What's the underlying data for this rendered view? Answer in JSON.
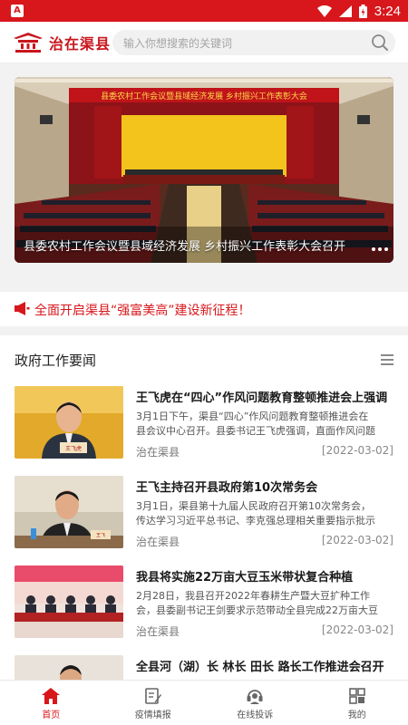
{
  "status_bar": {
    "time": "3:24",
    "app_badge": "A"
  },
  "header": {
    "logo_text": "治在渠县",
    "search_placeholder": "输入你想搜索的关键词"
  },
  "banner": {
    "caption": "县委农村工作会议暨县域经济发展 乡村振兴工作表彰大会召开",
    "stage_text": "县委农村工作会议暨县域经济发展  乡村振兴工作表彰大会"
  },
  "notice": {
    "text": "全面开启渠县“强富美高”建设新征程！"
  },
  "news": {
    "section_title": "政府工作要闻",
    "items": [
      {
        "title": "王飞虎在“四心”作风问题教育整顿推进会上强调",
        "summary_1": "3月1日下午，渠县“四心”作风问题教育整顿推进会在",
        "summary_2": "县会议中心召开。县委书记王飞虎强调，直面作风问题",
        "source": "治在渠县",
        "date": "[2022-03-02]",
        "nameplate": "王飞虎"
      },
      {
        "title": "王飞主持召开县政府第10次常务会",
        "summary_1": "3月1日，渠县第十九届人民政府召开第10次常务会，",
        "summary_2": "传达学习习近平总书记、李克强总理相关重要指示批示",
        "source": "治在渠县",
        "date": "[2022-03-02]",
        "nameplate": "王飞"
      },
      {
        "title": "我县将实施22万亩大豆玉米带状复合种植",
        "summary_1": "2月28日，我县召开2022年春耕生产暨大豆扩种工作",
        "summary_2": "会，县委副书记王剑要求示范带动全县完成22万亩大豆",
        "source": "治在渠县",
        "date": "[2022-03-02]",
        "nameplate": ""
      },
      {
        "title": "全县河（湖）长 林长 田长 路长工作推进会召开",
        "summary_1": "",
        "summary_2": "",
        "source": "",
        "date": "",
        "nameplate": ""
      }
    ]
  },
  "tabbar": {
    "tabs": [
      {
        "label": "首页",
        "icon": "home-icon"
      },
      {
        "label": "疫情填报",
        "icon": "edit-form-icon"
      },
      {
        "label": "在线投诉",
        "icon": "headset-icon"
      },
      {
        "label": "我的",
        "icon": "grid-icon"
      }
    ]
  },
  "colors": {
    "brand": "#d7171c",
    "text": "#1a1a1a",
    "muted": "#888888"
  }
}
